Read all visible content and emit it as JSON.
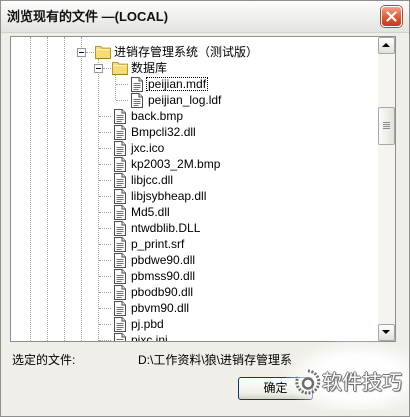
{
  "window": {
    "title": "浏览现有的文件 —(LOCAL)",
    "close_icon": "close-icon"
  },
  "tree": {
    "root": {
      "label": "进销存管理系统（测试版）",
      "icon": "folder-icon",
      "expanded": true,
      "children": [
        {
          "label": "数据库",
          "icon": "folder-icon",
          "expanded": true,
          "children": [
            {
              "label": "peijian.mdf",
              "icon": "file-icon",
              "selected": true
            },
            {
              "label": "peijian_log.ldf",
              "icon": "file-icon"
            }
          ]
        },
        {
          "label": "back.bmp",
          "icon": "file-icon"
        },
        {
          "label": "Bmpcli32.dll",
          "icon": "file-icon"
        },
        {
          "label": "jxc.ico",
          "icon": "file-icon"
        },
        {
          "label": "kp2003_2M.bmp",
          "icon": "file-icon"
        },
        {
          "label": "libjcc.dll",
          "icon": "file-icon"
        },
        {
          "label": "libjsybheap.dll",
          "icon": "file-icon"
        },
        {
          "label": "Md5.dll",
          "icon": "file-icon"
        },
        {
          "label": "ntwdblib.DLL",
          "icon": "file-icon"
        },
        {
          "label": "p_print.srf",
          "icon": "file-icon"
        },
        {
          "label": "pbdwe90.dll",
          "icon": "file-icon"
        },
        {
          "label": "pbmss90.dll",
          "icon": "file-icon"
        },
        {
          "label": "pbodb90.dll",
          "icon": "file-icon"
        },
        {
          "label": "pbvm90.dll",
          "icon": "file-icon"
        },
        {
          "label": "pj.pbd",
          "icon": "file-icon"
        },
        {
          "label": "pjxc.ini",
          "icon": "file-icon"
        }
      ]
    },
    "scroll_fraction": 0.23
  },
  "footer": {
    "selected_file_label": "选定的文件:",
    "selected_file_path": "D:\\工作资料\\狼\\进销存管理系",
    "ok_button": "确定"
  },
  "watermark": {
    "text": "软件技巧",
    "logo_icon": "watermark-logo"
  },
  "colors": {
    "dialog_background": "#efeee8",
    "close_button": "#dd5f3e",
    "tree_background": "#ffffff",
    "button_border": "#003c74"
  }
}
